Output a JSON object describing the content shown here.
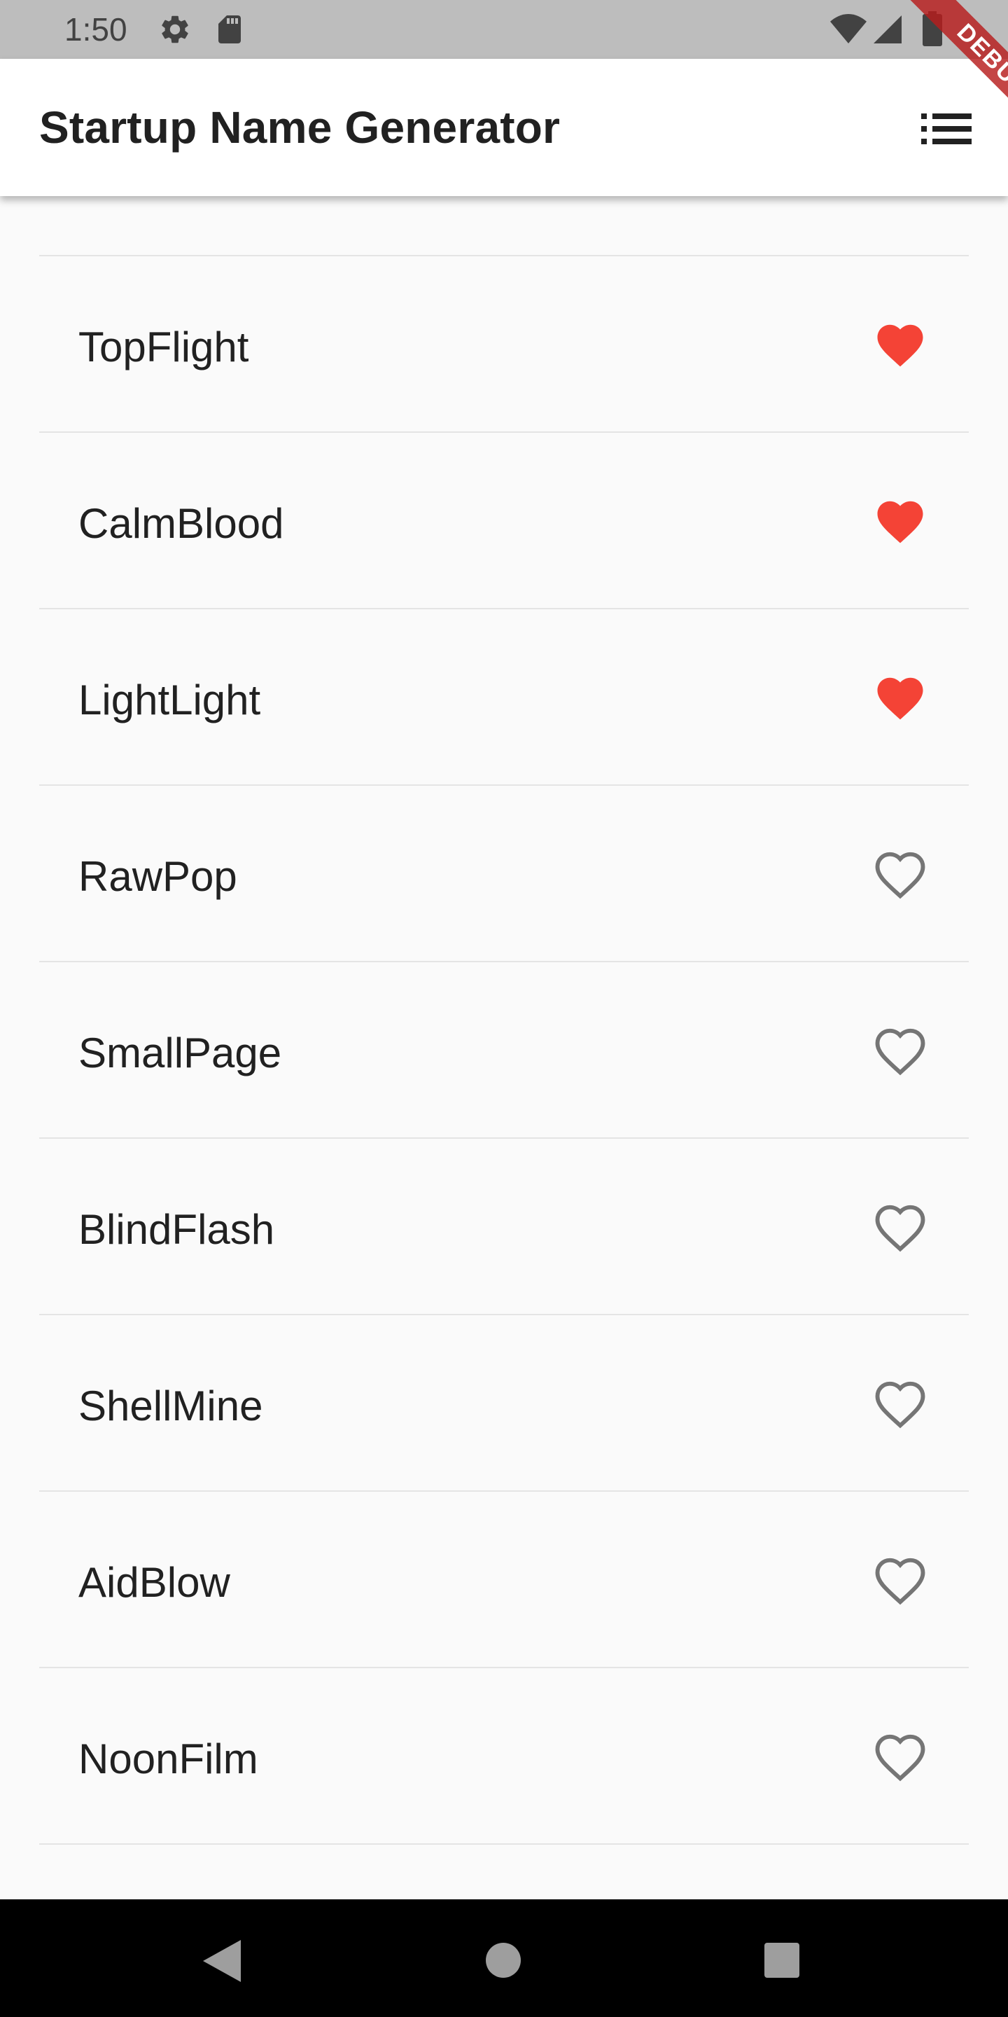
{
  "status_bar": {
    "time": "1:50",
    "icons": [
      "settings-icon",
      "sd-card-icon",
      "wifi-icon",
      "signal-icon",
      "battery-icon"
    ]
  },
  "debug_banner": {
    "label": "DEBUG"
  },
  "app_bar": {
    "title": "Startup Name Generator",
    "action_icon": "list-icon"
  },
  "colors": {
    "favorite": "#f44336",
    "unfavorite": "#757575",
    "status_bar": "#bdbdbd",
    "app_bar": "#ffffff",
    "background": "#fafafa"
  },
  "list": {
    "items": [
      {
        "label": "TopFlight",
        "saved": true
      },
      {
        "label": "CalmBlood",
        "saved": true
      },
      {
        "label": "LightLight",
        "saved": true
      },
      {
        "label": "RawPop",
        "saved": false
      },
      {
        "label": "SmallPage",
        "saved": false
      },
      {
        "label": "BlindFlash",
        "saved": false
      },
      {
        "label": "ShellMine",
        "saved": false
      },
      {
        "label": "AidBlow",
        "saved": false
      },
      {
        "label": "NoonFilm",
        "saved": false
      }
    ]
  },
  "nav_bar": {
    "buttons": [
      "back-icon",
      "home-icon",
      "recents-icon"
    ]
  }
}
